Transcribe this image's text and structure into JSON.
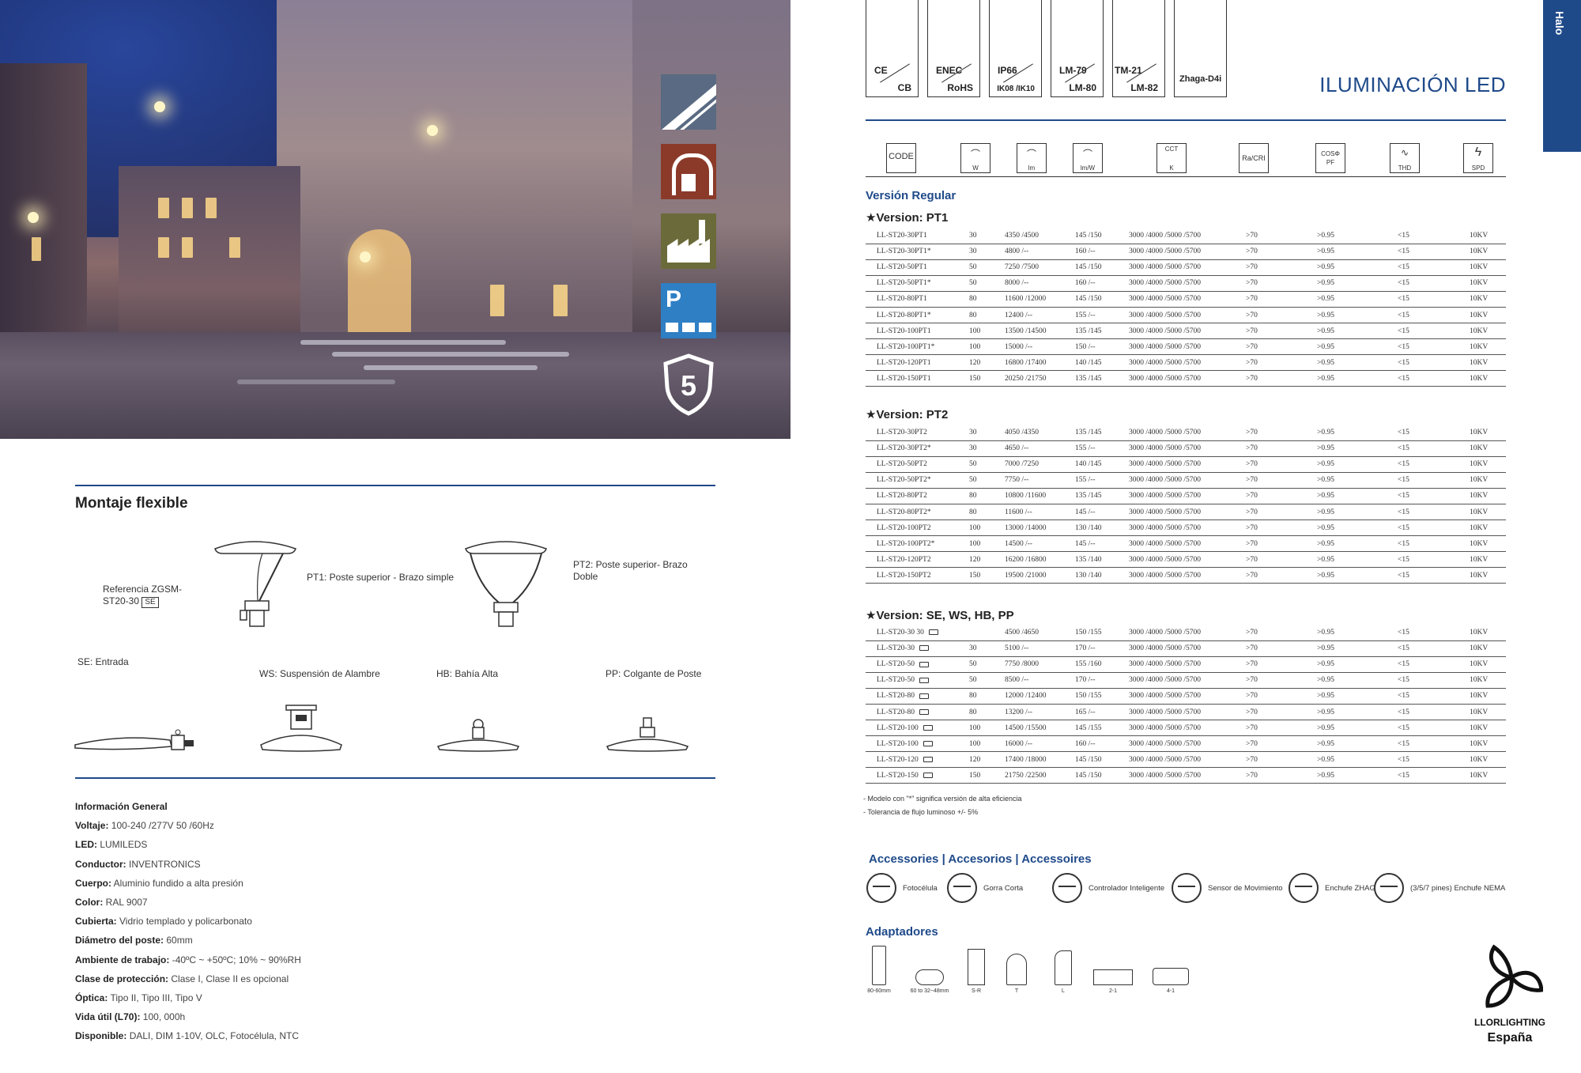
{
  "side_icon_badge": "5",
  "montaje": {
    "title": "Montaje flexible",
    "ref_label": "Referencia ZGSM-ST20-30",
    "ref_box": "SE",
    "pt1": "PT1: Poste superior - Brazo simple",
    "pt2": "PT2: Poste superior- Brazo Doble",
    "se": "SE: Entrada",
    "ws": "WS: Suspensión de Alambre",
    "hb": "HB: Bahía Alta",
    "pp": "PP: Colgante de Poste"
  },
  "info": {
    "heading": "Información General",
    "rows": [
      {
        "k": "Voltaje:",
        "v": "100-240 /277V 50 /60Hz"
      },
      {
        "k": "LED:",
        "v": "LUMILEDS"
      },
      {
        "k": "Conductor:",
        "v": "INVENTRONICS"
      },
      {
        "k": "Cuerpo:",
        "v": "Aluminio fundido a alta presión"
      },
      {
        "k": "Color:",
        "v": "RAL 9007"
      },
      {
        "k": "Cubierta:",
        "v": "Vidrio templado y policarbonato"
      },
      {
        "k": "Diámetro del poste:",
        "v": "60mm"
      },
      {
        "k": "Ambiente de trabajo:",
        "v": "-40ºC ~ +50ºC; 10% ~ 90%RH"
      },
      {
        "k": "Clase de protección:",
        "v": "Clase I, Clase II es opcional"
      },
      {
        "k": "Óptica:",
        "v": "Tipo II, Tipo III, Tipo V"
      },
      {
        "k": "Vida útil (L70):",
        "v": "100, 000h"
      },
      {
        "k": "Disponible:",
        "v": "DALI, DIM 1-10V, OLC, Fotocélula, NTC"
      }
    ]
  },
  "certs": [
    {
      "a": "CE",
      "b": "CB"
    },
    {
      "a": "ENEC",
      "b": "RoHS"
    },
    {
      "a": "IP66",
      "b": "IK08 /IK10"
    },
    {
      "a": "LM-79",
      "b": "LM-80"
    },
    {
      "a": "TM-21",
      "b": "LM-82"
    },
    {
      "a": "Zhaga-D4i",
      "b": ""
    }
  ],
  "page_title": "ILUMINACIÓN LED",
  "side_tab": "Halo",
  "header_icons": [
    {
      "glyph": "CODE",
      "label": ""
    },
    {
      "glyph": "",
      "label": "W"
    },
    {
      "glyph": "",
      "label": "lm"
    },
    {
      "glyph": "",
      "label": "lm/W"
    },
    {
      "glyph": "CCT",
      "label": "K"
    },
    {
      "glyph": "Ra/CRI",
      "label": ""
    },
    {
      "glyph": "COSΦ",
      "label": "PF"
    },
    {
      "glyph": "",
      "label": "THD"
    },
    {
      "glyph": "",
      "label": "SPD"
    }
  ],
  "version_regular": "Versión Regular",
  "versions": [
    {
      "title": "★Version: PT1",
      "rows": [
        [
          "LL-ST20-30PT1",
          "30",
          "4350 /4500",
          "145 /150",
          "3000 /4000 /5000 /5700",
          ">70",
          ">0.95",
          "<15",
          "10KV"
        ],
        [
          "LL-ST20-30PT1*",
          "30",
          "4800 /--",
          "160 /--",
          "3000 /4000 /5000 /5700",
          ">70",
          ">0.95",
          "<15",
          "10KV"
        ],
        [
          "LL-ST20-50PT1",
          "50",
          "7250 /7500",
          "145 /150",
          "3000 /4000 /5000 /5700",
          ">70",
          ">0.95",
          "<15",
          "10KV"
        ],
        [
          "LL-ST20-50PT1*",
          "50",
          "8000 /--",
          "160 /--",
          "3000 /4000 /5000 /5700",
          ">70",
          ">0.95",
          "<15",
          "10KV"
        ],
        [
          "LL-ST20-80PT1",
          "80",
          "11600 /12000",
          "145 /150",
          "3000 /4000 /5000 /5700",
          ">70",
          ">0.95",
          "<15",
          "10KV"
        ],
        [
          "LL-ST20-80PT1*",
          "80",
          "12400 /--",
          "155 /--",
          "3000 /4000 /5000 /5700",
          ">70",
          ">0.95",
          "<15",
          "10KV"
        ],
        [
          "LL-ST20-100PT1",
          "100",
          "13500 /14500",
          "135 /145",
          "3000 /4000 /5000 /5700",
          ">70",
          ">0.95",
          "<15",
          "10KV"
        ],
        [
          "LL-ST20-100PT1*",
          "100",
          "15000 /--",
          "150 /--",
          "3000 /4000 /5000 /5700",
          ">70",
          ">0.95",
          "<15",
          "10KV"
        ],
        [
          "LL-ST20-120PT1",
          "120",
          "16800 /17400",
          "140 /145",
          "3000 /4000 /5000 /5700",
          ">70",
          ">0.95",
          "<15",
          "10KV"
        ],
        [
          "LL-ST20-150PT1",
          "150",
          "20250 /21750",
          "135 /145",
          "3000 /4000 /5000 /5700",
          ">70",
          ">0.95",
          "<15",
          "10KV"
        ]
      ]
    },
    {
      "title": "★Version: PT2",
      "rows": [
        [
          "LL-ST20-30PT2",
          "30",
          "4050 /4350",
          "135 /145",
          "3000 /4000 /5000 /5700",
          ">70",
          ">0.95",
          "<15",
          "10KV"
        ],
        [
          "LL-ST20-30PT2*",
          "30",
          "4650 /--",
          "155 /--",
          "3000 /4000 /5000 /5700",
          ">70",
          ">0.95",
          "<15",
          "10KV"
        ],
        [
          "LL-ST20-50PT2",
          "50",
          "7000 /7250",
          "140 /145",
          "3000 /4000 /5000 /5700",
          ">70",
          ">0.95",
          "<15",
          "10KV"
        ],
        [
          "LL-ST20-50PT2*",
          "50",
          "7750 /--",
          "155 /--",
          "3000 /4000 /5000 /5700",
          ">70",
          ">0.95",
          "<15",
          "10KV"
        ],
        [
          "LL-ST20-80PT2",
          "80",
          "10800 /11600",
          "135 /145",
          "3000 /4000 /5000 /5700",
          ">70",
          ">0.95",
          "<15",
          "10KV"
        ],
        [
          "LL-ST20-80PT2*",
          "80",
          "11600 /--",
          "145 /--",
          "3000 /4000 /5000 /5700",
          ">70",
          ">0.95",
          "<15",
          "10KV"
        ],
        [
          "LL-ST20-100PT2",
          "100",
          "13000 /14000",
          "130 /140",
          "3000 /4000 /5000 /5700",
          ">70",
          ">0.95",
          "<15",
          "10KV"
        ],
        [
          "LL-ST20-100PT2*",
          "100",
          "14500 /--",
          "145 /--",
          "3000 /4000 /5000 /5700",
          ">70",
          ">0.95",
          "<15",
          "10KV"
        ],
        [
          "LL-ST20-120PT2",
          "120",
          "16200 /16800",
          "135 /140",
          "3000 /4000 /5000 /5700",
          ">70",
          ">0.95",
          "<15",
          "10KV"
        ],
        [
          "LL-ST20-150PT2",
          "150",
          "19500 /21000",
          "130 /140",
          "3000 /4000 /5000 /5700",
          ">70",
          ">0.95",
          "<15",
          "10KV"
        ]
      ]
    },
    {
      "title": "★Version: SE, WS, HB, PP",
      "rows": [
        [
          "LL-ST20-30 30",
          "",
          "4500 /4650",
          "150 /155",
          "3000 /4000 /5000 /5700",
          ">70",
          ">0.95",
          "<15",
          "10KV"
        ],
        [
          "LL-ST20-30",
          "30",
          "5100 /--",
          "170 /--",
          "3000 /4000 /5000 /5700",
          ">70",
          ">0.95",
          "<15",
          "10KV"
        ],
        [
          "LL-ST20-50",
          "50",
          "7750 /8000",
          "155 /160",
          "3000 /4000 /5000 /5700",
          ">70",
          ">0.95",
          "<15",
          "10KV"
        ],
        [
          "LL-ST20-50",
          "50",
          "8500 /--",
          "170 /--",
          "3000 /4000 /5000 /5700",
          ">70",
          ">0.95",
          "<15",
          "10KV"
        ],
        [
          "LL-ST20-80",
          "80",
          "12000 /12400",
          "150 /155",
          "3000 /4000 /5000 /5700",
          ">70",
          ">0.95",
          "<15",
          "10KV"
        ],
        [
          "LL-ST20-80",
          "80",
          "13200 /--",
          "165 /--",
          "3000 /4000 /5000 /5700",
          ">70",
          ">0.95",
          "<15",
          "10KV"
        ],
        [
          "LL-ST20-100",
          "100",
          "14500 /15500",
          "145 /155",
          "3000 /4000 /5000 /5700",
          ">70",
          ">0.95",
          "<15",
          "10KV"
        ],
        [
          "LL-ST20-100",
          "100",
          "16000 /--",
          "160 /--",
          "3000 /4000 /5000 /5700",
          ">70",
          ">0.95",
          "<15",
          "10KV"
        ],
        [
          "LL-ST20-120",
          "120",
          "17400 /18000",
          "145 /150",
          "3000 /4000 /5000 /5700",
          ">70",
          ">0.95",
          "<15",
          "10KV"
        ],
        [
          "LL-ST20-150",
          "150",
          "21750 /22500",
          "145 /150",
          "3000 /4000 /5000 /5700",
          ">70",
          ">0.95",
          "<15",
          "10KV"
        ]
      ]
    }
  ],
  "notes": [
    "- Modelo con \"*\" significa versión de alta eficiencia",
    "- Tolerancia de flujo luminoso +/- 5%"
  ],
  "accessories": {
    "title": "Accessories | Accesorios | Accessoires",
    "items": [
      "Fotocélula",
      "Gorra Corta",
      "Controlador Inteligente",
      "Sensor de Movimiento",
      "Enchufe ZHAGA",
      "(3/5/7 pines) Enchufe NEMA"
    ]
  },
  "adapters": {
    "title": "Adaptadores",
    "items": [
      "80-60mm",
      "60 to 32~48mm",
      "S-R",
      "T",
      "L",
      "2-1",
      "4-1"
    ]
  },
  "brand": {
    "name": "LLORLIGHTING",
    "country": "España"
  }
}
